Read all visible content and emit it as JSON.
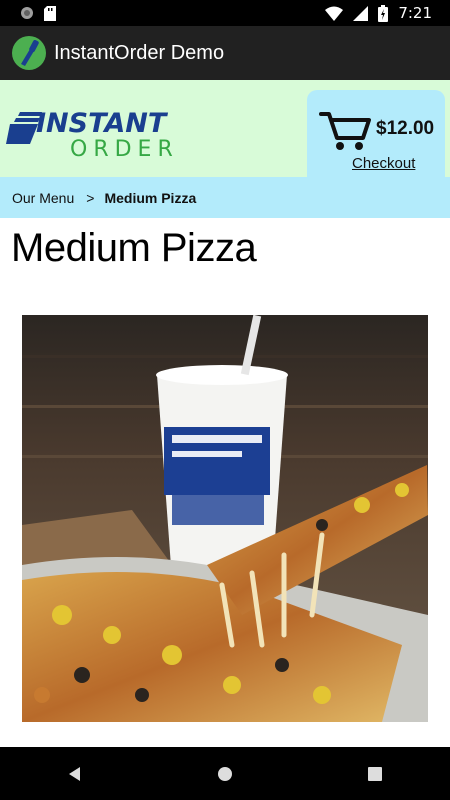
{
  "status_bar": {
    "time": "7:21"
  },
  "app_bar": {
    "title": "InstantOrder Demo"
  },
  "header": {
    "logo_line1": "INSTANT",
    "logo_line2": "ORDER",
    "cart_total": "$12.00",
    "checkout_label": "Checkout"
  },
  "breadcrumb": {
    "parent": "Our Menu",
    "separator": ">",
    "current": "Medium Pizza"
  },
  "page": {
    "title": "Medium Pizza"
  },
  "colors": {
    "header_bg": "#d8fbd8",
    "accent_bg": "#b3ebfb",
    "logo_blue": "#1a3f8f",
    "logo_green": "#36a845",
    "app_bar": "#212121"
  },
  "icons": [
    "camera-icon",
    "sd-card-icon",
    "wifi-icon",
    "signal-icon",
    "battery-icon",
    "cart-icon",
    "back-icon",
    "home-icon",
    "recents-icon"
  ]
}
